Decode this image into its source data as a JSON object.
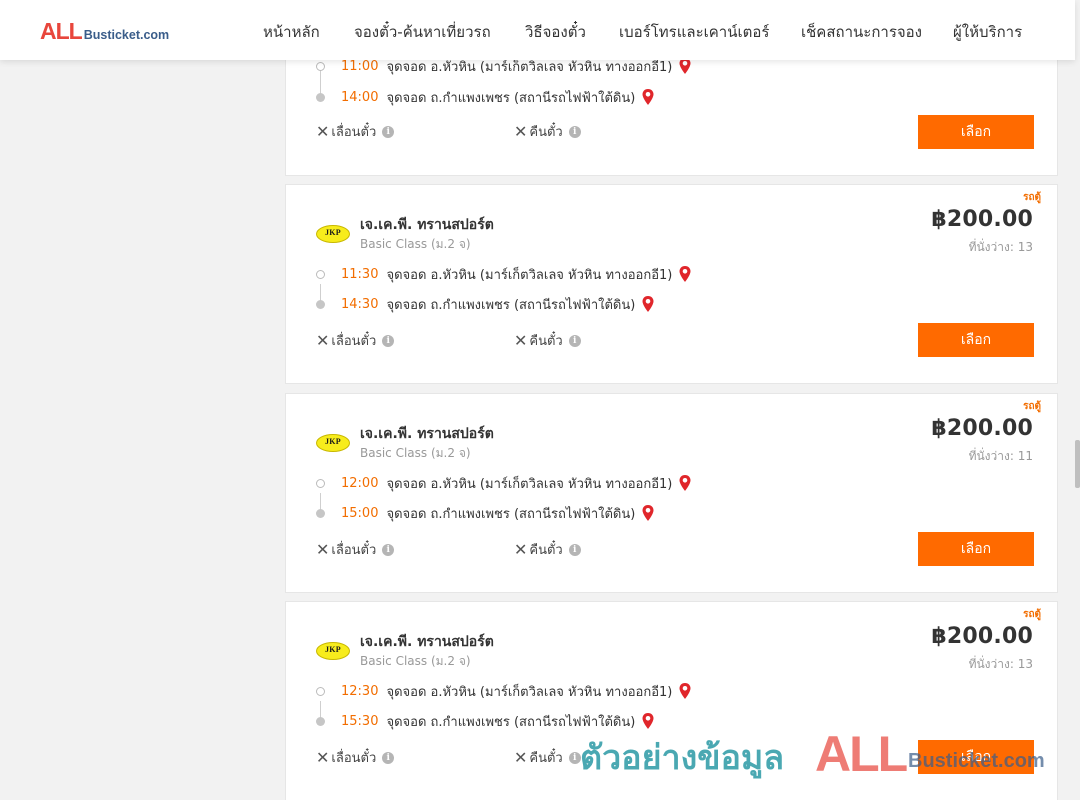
{
  "header": {
    "logo_all": "ALL",
    "logo_rest": "Busticket.com",
    "nav": [
      {
        "label": "หน้าหลัก"
      },
      {
        "label": "จองตั๋ว-ค้นหาเที่ยวรถ"
      },
      {
        "label": "วิธีจองตั๋ว"
      },
      {
        "label": "เบอร์โทรและเคาน์เตอร์"
      },
      {
        "label": "เช็คสถานะการจอง"
      },
      {
        "label": "ผู้ให้บริการ"
      }
    ]
  },
  "labels": {
    "postpone": "เลื่อนตั๋ว",
    "refund": "คืนตั๋ว",
    "select": "เลือก",
    "info": "i"
  },
  "colors": {
    "accent": "#ff6a00",
    "time": "#f26d00",
    "logo_red": "#e8463c",
    "logo_blue": "#3a5d8a",
    "pin": "#e0262b"
  },
  "top_card": {
    "departure_time": "11:00",
    "departure_place": "จุดจอด อ.หัวหิน (มาร์เก็ตวิลเลจ หัวหิน ทางออกอี1)",
    "arrival_time": "14:00",
    "arrival_place": "จุดจอด ถ.กำแพงเพชร (สถานีรถไฟฟ้าใต้ดิน)"
  },
  "trips": [
    {
      "logo_text": "JKP",
      "company": "เจ.เค.พี. ทรานสปอร์ต",
      "bus_class": "Basic Class (ม.2 จ)",
      "bus_type": "รถตู้",
      "price": "฿200.00",
      "seats": "ที่นั่งว่าง: 13",
      "departure_time": "11:30",
      "departure_place": "จุดจอด อ.หัวหิน (มาร์เก็ตวิลเลจ หัวหิน ทางออกอี1)",
      "arrival_time": "14:30",
      "arrival_place": "จุดจอด ถ.กำแพงเพชร (สถานีรถไฟฟ้าใต้ดิน)"
    },
    {
      "logo_text": "JKP",
      "company": "เจ.เค.พี. ทรานสปอร์ต",
      "bus_class": "Basic Class (ม.2 จ)",
      "bus_type": "รถตู้",
      "price": "฿200.00",
      "seats": "ที่นั่งว่าง: 11",
      "departure_time": "12:00",
      "departure_place": "จุดจอด อ.หัวหิน (มาร์เก็ตวิลเลจ หัวหิน ทางออกอี1)",
      "arrival_time": "15:00",
      "arrival_place": "จุดจอด ถ.กำแพงเพชร (สถานีรถไฟฟ้าใต้ดิน)"
    },
    {
      "logo_text": "JKP",
      "company": "เจ.เค.พี. ทรานสปอร์ต",
      "bus_class": "Basic Class (ม.2 จ)",
      "bus_type": "รถตู้",
      "price": "฿200.00",
      "seats": "ที่นั่งว่าง: 13",
      "departure_time": "12:30",
      "departure_place": "จุดจอด อ.หัวหิน (มาร์เก็ตวิลเลจ หัวหิน ทางออกอี1)",
      "arrival_time": "15:30",
      "arrival_place": "จุดจอด ถ.กำแพงเพชร (สถานีรถไฟฟ้าใต้ดิน)"
    }
  ],
  "watermark": {
    "text": "ตัวอย่างข้อมูล",
    "logo_all": "ALL",
    "logo_rest": "Busticket.com"
  }
}
